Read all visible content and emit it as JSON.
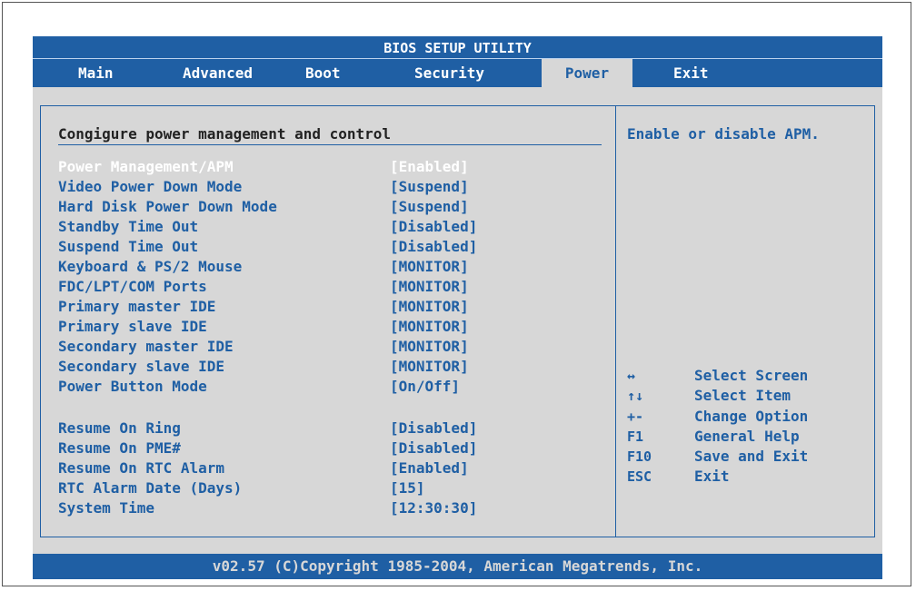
{
  "title": "BIOS SETUP UTILITY",
  "tabs": [
    {
      "label": "Main"
    },
    {
      "label": "Advanced"
    },
    {
      "label": "Boot"
    },
    {
      "label": "Security"
    },
    {
      "label": "Power"
    },
    {
      "label": "Exit"
    }
  ],
  "active_tab": "Power",
  "section_title": "Congigure power management and control",
  "settings": [
    {
      "label": "Power Management/APM",
      "value": "[Enabled]"
    },
    {
      "label": "Video Power Down Mode",
      "value": "[Suspend]"
    },
    {
      "label": "Hard Disk Power Down Mode",
      "value": "[Suspend]"
    },
    {
      "label": "Standby Time Out",
      "value": "[Disabled]"
    },
    {
      "label": "Suspend Time Out",
      "value": "[Disabled]"
    },
    {
      "label": "Keyboard & PS/2 Mouse",
      "value": "[MONITOR]"
    },
    {
      "label": "FDC/LPT/COM Ports",
      "value": "[MONITOR]"
    },
    {
      "label": "Primary master IDE",
      "value": "[MONITOR]"
    },
    {
      "label": "Primary slave IDE",
      "value": "[MONITOR]"
    },
    {
      "label": "Secondary master IDE",
      "value": "[MONITOR]"
    },
    {
      "label": "Secondary slave IDE",
      "value": "[MONITOR]"
    },
    {
      "label": "Power Button Mode",
      "value": "[On/Off]"
    },
    {
      "label": "Resume On Ring",
      "value": "[Disabled]"
    },
    {
      "label": "Resume On PME#",
      "value": "[Disabled]"
    },
    {
      "label": "Resume On RTC Alarm",
      "value": "[Enabled]"
    },
    {
      "label": "RTC Alarm Date (Days)",
      "value": "[15]"
    },
    {
      "label": "System Time",
      "value": "[12:30:30]"
    }
  ],
  "help": {
    "text": "Enable or disable APM."
  },
  "keys": [
    {
      "key": "↔",
      "action": "Select Screen"
    },
    {
      "key": "↑↓",
      "action": "Select Item"
    },
    {
      "key": "+-",
      "action": "Change Option"
    },
    {
      "key": "F1",
      "action": "General Help"
    },
    {
      "key": "F10",
      "action": "Save and Exit"
    },
    {
      "key": "ESC",
      "action": "Exit"
    }
  ],
  "footer": "v02.57 (C)Copyright 1985-2004, American Megatrends, Inc.",
  "colors": {
    "accent": "#1f5fa4",
    "panel": "#d7d7d7",
    "selected_text": "#ffffff"
  }
}
